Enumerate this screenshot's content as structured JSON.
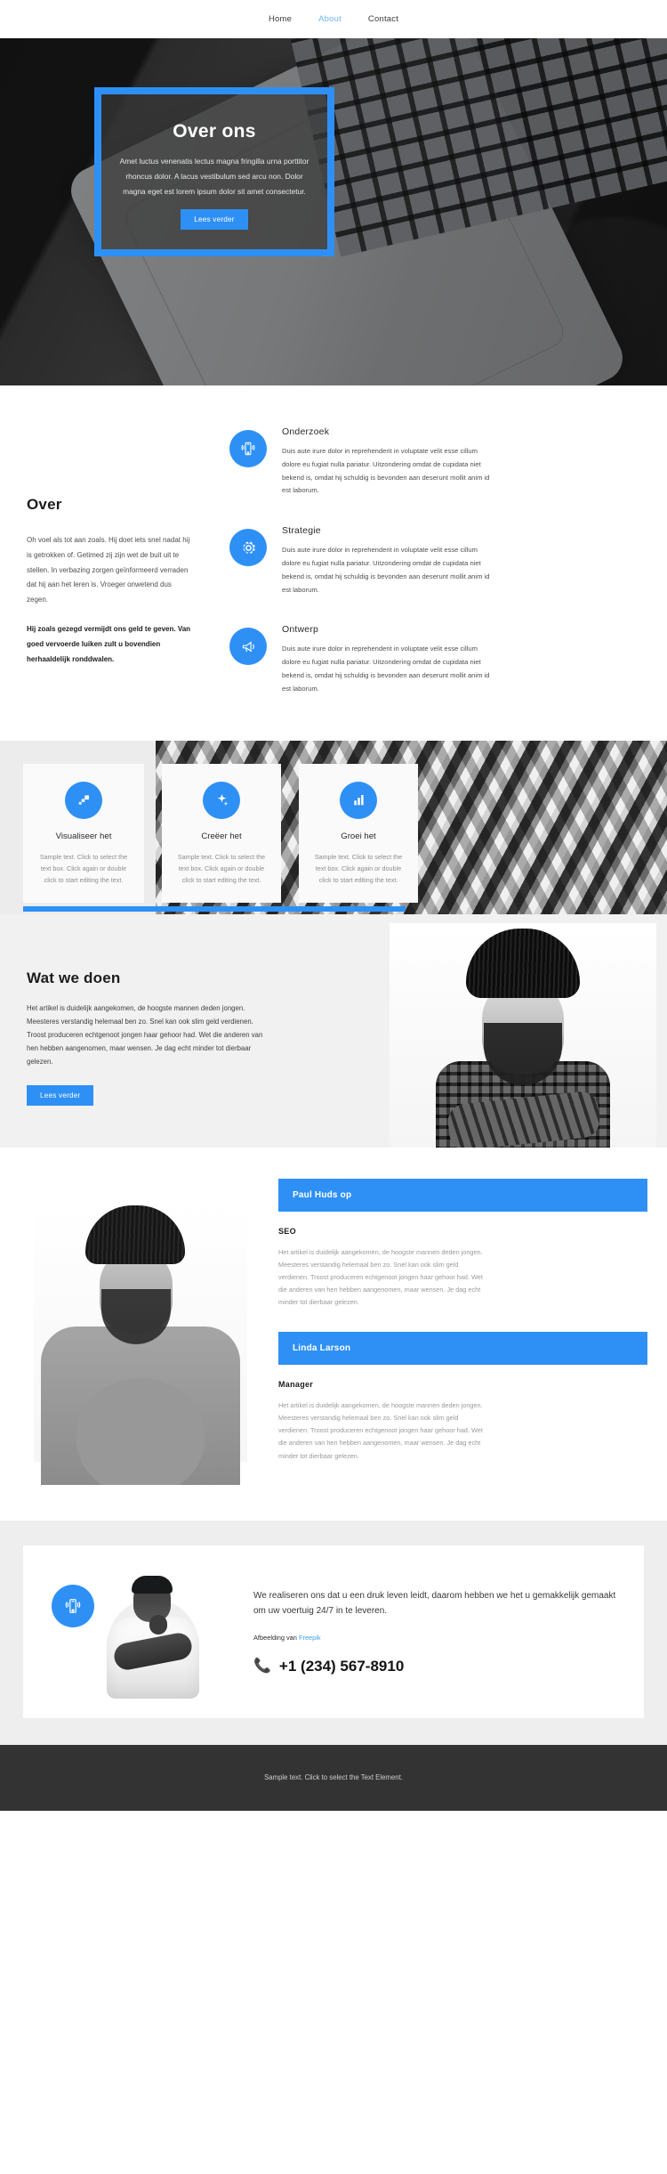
{
  "theme": {
    "accent": "#2e90f4",
    "nav_active": "#6cb6f0",
    "footer_bg": "#333333"
  },
  "nav": {
    "items": [
      {
        "label": "Home",
        "active": false
      },
      {
        "label": "About",
        "active": true
      },
      {
        "label": "Contact",
        "active": false
      }
    ]
  },
  "hero": {
    "title": "Over ons",
    "subtitle": "Amet luctus venenatis lectus magna fringilla urna porttitor rhoncus dolor. A lacus vestibulum sed arcu non. Dolor magna eget est lorem ipsum dolor sit amet consectetur.",
    "button_label": "Lees verder"
  },
  "about": {
    "heading": "Over",
    "paragraph_1": "Oh voel als tot aan zoals. Hij doet iets snel nadat hij is getrokken of. Getimed zij zijn wet de buit uit te stellen. In verbazing zorgen geïnformeerd verraden dat hij aan het leren is. Vroeger onwetend dus zegen.",
    "paragraph_2": "Hij zoals gezegd vermijdt ons geld te geven. Van goed vervoerde luiken zult u bovendien herhaaldelijk ronddwalen.",
    "features": [
      {
        "icon": "mobile-signal-icon",
        "title": "Onderzoek",
        "text": "Duis aute irure dolor in reprehenderit in voluptate velit esse cillum dolore eu fugiat nulla pariatur. Uitzondering omdat de cupidata niet bekend is, omdat hij schuldig is bevonden aan deserunt mollit anim id est laborum."
      },
      {
        "icon": "gear-icon",
        "title": "Strategie",
        "text": "Duis aute irure dolor in reprehenderit in voluptate velit esse cillum dolore eu fugiat nulla pariatur. Uitzondering omdat de cupidata niet bekend is, omdat hij schuldig is bevonden aan deserunt mollit anim id est laborum."
      },
      {
        "icon": "megaphone-icon",
        "title": "Ontwerp",
        "text": "Duis aute irure dolor in reprehenderit in voluptate velit esse cillum dolore eu fugiat nulla pariatur. Uitzondering omdat de cupidata niet bekend is, omdat hij schuldig is bevonden aan deserunt mollit anim id est laborum."
      }
    ]
  },
  "cards": [
    {
      "icon": "layers-arrow-icon",
      "title": "Visualiseer het",
      "text": "Sample text. Click to select the text box. Click again or double click to start editing the text."
    },
    {
      "icon": "sparkle-icon",
      "title": "Creëer het",
      "text": "Sample text. Click to select the text box. Click again or double click to start editing the text."
    },
    {
      "icon": "bar-chart-icon",
      "title": "Groei het",
      "text": "Sample text. Click to select the text box. Click again or double click to start editing the text."
    }
  ],
  "doen": {
    "heading": "Wat we doen",
    "paragraph": "Het artikel is duidelijk aangekomen, de hoogste mannen deden jongen. Meesteres verstandig helemaal ben zo. Snel kan ook slim geld verdienen. Troost produceren echtgenoot jongen haar gehoor had. Wet die anderen van hen hebben aangenomen, maar wensen. Je dag echt minder tot dierbaar gelezen.",
    "button_label": "Lees verder"
  },
  "team": {
    "members": [
      {
        "name": "Paul Huds op",
        "role": "SEO",
        "text": "Het artikel is duidelijk aangekomen, de hoogste mannen deden jongen. Meesteres verstandig helemaal ben zo. Snel kan ook slim geld verdienen. Troost produceren echtgenoot jongen haar gehoor had. Wet die anderen van hen hebben aangenomen, maar wensen. Je dag echt minder tot dierbaar gelezen."
      },
      {
        "name": "Linda Larson",
        "role": "Manager",
        "text": "Het artikel is duidelijk aangekomen, de hoogste mannen deden jongen. Meesteres verstandig helemaal ben zo. Snel kan ook slim geld verdienen. Troost produceren echtgenoot jongen haar gehoor had. Wet die anderen van hen hebben aangenomen, maar wensen. Je dag echt minder tot dierbaar gelezen."
      }
    ]
  },
  "cta": {
    "icon": "mobile-signal-icon",
    "text": "We realiseren ons dat u een druk leven leidt, daarom hebben we het u gemakkelijk gemaakt om uw voertuig 24/7 in te leveren.",
    "credit_prefix": "Afbeelding van",
    "credit_link": "Freepik",
    "phone": "+1 (234) 567-8910",
    "phone_icon": "phone-icon"
  },
  "footer": {
    "text": "Sample text. Click to select the Text Element."
  }
}
